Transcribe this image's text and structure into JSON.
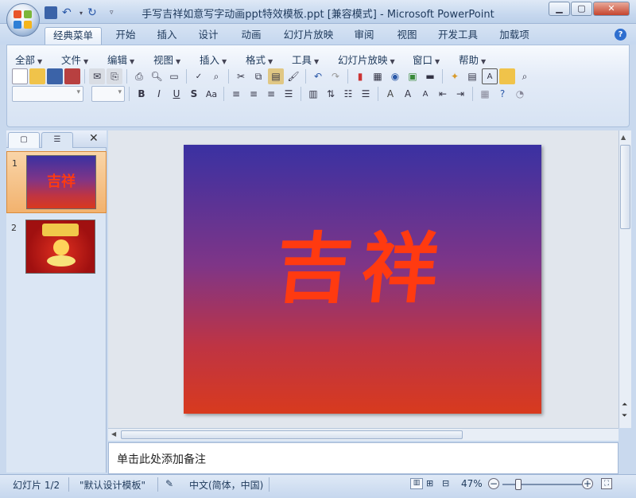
{
  "window": {
    "title": "手写吉祥如意写字动画ppt特效模板.ppt [兼容模式] - Microsoft PowerPoint"
  },
  "tabs": [
    "经典菜单",
    "开始",
    "插入",
    "设计",
    "动画",
    "幻灯片放映",
    "审阅",
    "视图",
    "开发工具",
    "加载项"
  ],
  "menu": [
    "全部",
    "文件",
    "编辑",
    "视图",
    "插入",
    "格式",
    "工具",
    "幻灯片放映",
    "窗口",
    "帮助"
  ],
  "slides": [
    {
      "num": "1"
    },
    {
      "num": "2"
    }
  ],
  "slide": {
    "text": "吉祥",
    "thumb_text": "吉祥"
  },
  "notes": {
    "placeholder": "单击此处添加备注"
  },
  "status": {
    "slide": "幻灯片 1/2",
    "theme": "\"默认设计模板\"",
    "lang": "中文(简体，中国)",
    "zoom": "47%"
  },
  "colors": {
    "accent": "#1e395b",
    "slide_text": "#ff3a10"
  }
}
